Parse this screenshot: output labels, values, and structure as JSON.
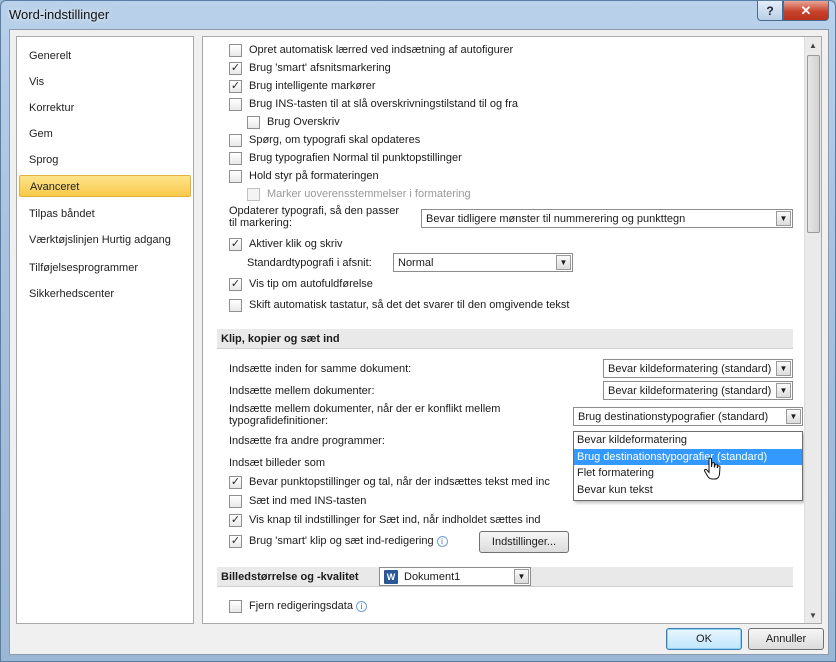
{
  "window": {
    "title": "Word-indstillinger",
    "help_glyph": "?",
    "close_glyph": "✕"
  },
  "nav": {
    "items": [
      {
        "label": "Generelt"
      },
      {
        "label": "Vis"
      },
      {
        "label": "Korrektur"
      },
      {
        "label": "Gem"
      },
      {
        "label": "Sprog"
      },
      {
        "label": "Avanceret"
      },
      {
        "label": "Tilpas båndet"
      },
      {
        "label": "Værktøjslinjen Hurtig adgang"
      },
      {
        "label": "Tilføjelsesprogrammer"
      },
      {
        "label": "Sikkerhedscenter"
      }
    ],
    "active_index": 5
  },
  "content": {
    "editing_options": [
      {
        "label": "Opret automatisk lærred ved indsætning af autofigurer",
        "checked": false
      },
      {
        "label": "Brug 'smart' afsnitsmarkering",
        "checked": true
      },
      {
        "label": "Brug intelligente markører",
        "checked": true
      },
      {
        "label": "Brug INS-tasten til at slå overskrivningstilstand til og fra",
        "checked": false
      },
      {
        "label": "Brug Overskriv",
        "checked": false
      },
      {
        "label": "Spørg, om typografi skal opdateres",
        "checked": false
      },
      {
        "label": "Brug typografien Normal til punktopstillinger",
        "checked": false
      },
      {
        "label": "Hold styr på formateringen",
        "checked": false
      },
      {
        "label": "Marker uoverensstemmelser i formatering",
        "checked": false,
        "disabled": true
      }
    ],
    "update_style": {
      "label_line1": "Opdaterer typografi, så den passer",
      "label_line2": "til markering:",
      "value": "Bevar tidligere mønster til nummerering og punkttegn"
    },
    "click_and_type": {
      "label": "Aktiver klik og skriv",
      "checked": true
    },
    "default_paragraph": {
      "label": "Standardtypografi i afsnit:",
      "value": "Normal"
    },
    "autocomplete": {
      "label": "Vis tip om autofuldførelse",
      "checked": true
    },
    "keyboard_switch": {
      "label": "Skift automatisk tastatur, så det det svarer til den omgivende tekst",
      "checked": false
    },
    "paste_section": {
      "title": "Klip, kopier og sæt ind",
      "same_doc": {
        "label": "Indsætte inden for samme dokument:",
        "value": "Bevar kildeformatering (standard)"
      },
      "between_docs": {
        "label": "Indsætte mellem dokumenter:",
        "value": "Bevar kildeformatering (standard)"
      },
      "conflict": {
        "label_line1": "Indsætte mellem dokumenter, når der er konflikt mellem",
        "label_line2": "typografidefinitioner:",
        "value": "Brug destinationstypografier (standard)"
      },
      "other_programs": {
        "label": "Indsætte fra andre programmer:"
      },
      "dropdown_options": [
        "Bevar kildeformatering",
        "Brug destinationstypografier (standard)",
        "Flet formatering",
        "Bevar kun tekst"
      ],
      "dropdown_selected_index": 1,
      "insert_images": {
        "label": "Indsæt billeder som"
      },
      "options": [
        {
          "label": "Bevar punktopstillinger og tal, når der indsættes tekst med inc",
          "checked": true
        },
        {
          "label": "Sæt ind med INS-tasten",
          "checked": false
        },
        {
          "label": "Vis knap til indstillinger for Sæt ind, når indholdet sættes ind",
          "checked": true
        },
        {
          "label": "Brug 'smart' klip og sæt ind-redigering",
          "checked": true
        }
      ],
      "settings_button": "Indstillinger..."
    },
    "image_section": {
      "title": "Billedstørrelse og -kvalitet",
      "document": "Dokument1",
      "doc_icon_letter": "W"
    },
    "discard_editing": {
      "label": "Fjern redigeringsdata",
      "checked": false
    }
  },
  "footer": {
    "ok": "OK",
    "cancel": "Annuller"
  },
  "glyphs": {
    "check": "✓",
    "down": "▼",
    "up": "▲",
    "info": "i"
  },
  "colors": {
    "accent_selected": "#3399ff",
    "nav_active": "#f8c94a"
  }
}
